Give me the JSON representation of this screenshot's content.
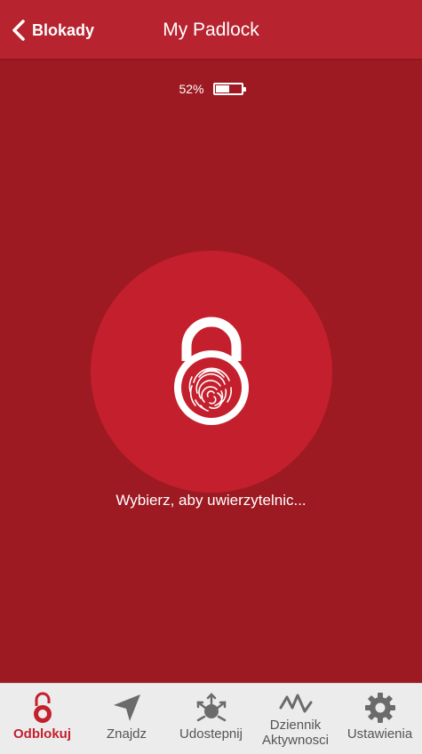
{
  "header": {
    "back_label": "Blokady",
    "title": "My Padlock"
  },
  "battery": {
    "percent_label": "52%",
    "level": 0.52
  },
  "main": {
    "prompt": "Wybierz, aby uwierzytelnic..."
  },
  "bottom_nav": {
    "items": [
      {
        "label": "Odblokuj",
        "icon": "unlock-icon",
        "active": true
      },
      {
        "label": "Znajdz",
        "icon": "navigation-arrow-icon",
        "active": false
      },
      {
        "label": "Udostepnij",
        "icon": "share-icon",
        "active": false
      },
      {
        "label_line1": "Dziennik",
        "label_line2": "Aktywnosci",
        "icon": "activity-log-icon",
        "active": false
      },
      {
        "label": "Ustawienia",
        "icon": "gear-icon",
        "active": false
      }
    ]
  },
  "colors": {
    "background": "#9e1a22",
    "header": "#b7232f",
    "circle": "#c41f2c",
    "nav_background": "#ececec",
    "active": "#c41f2c",
    "inactive": "#6b6b6b"
  }
}
